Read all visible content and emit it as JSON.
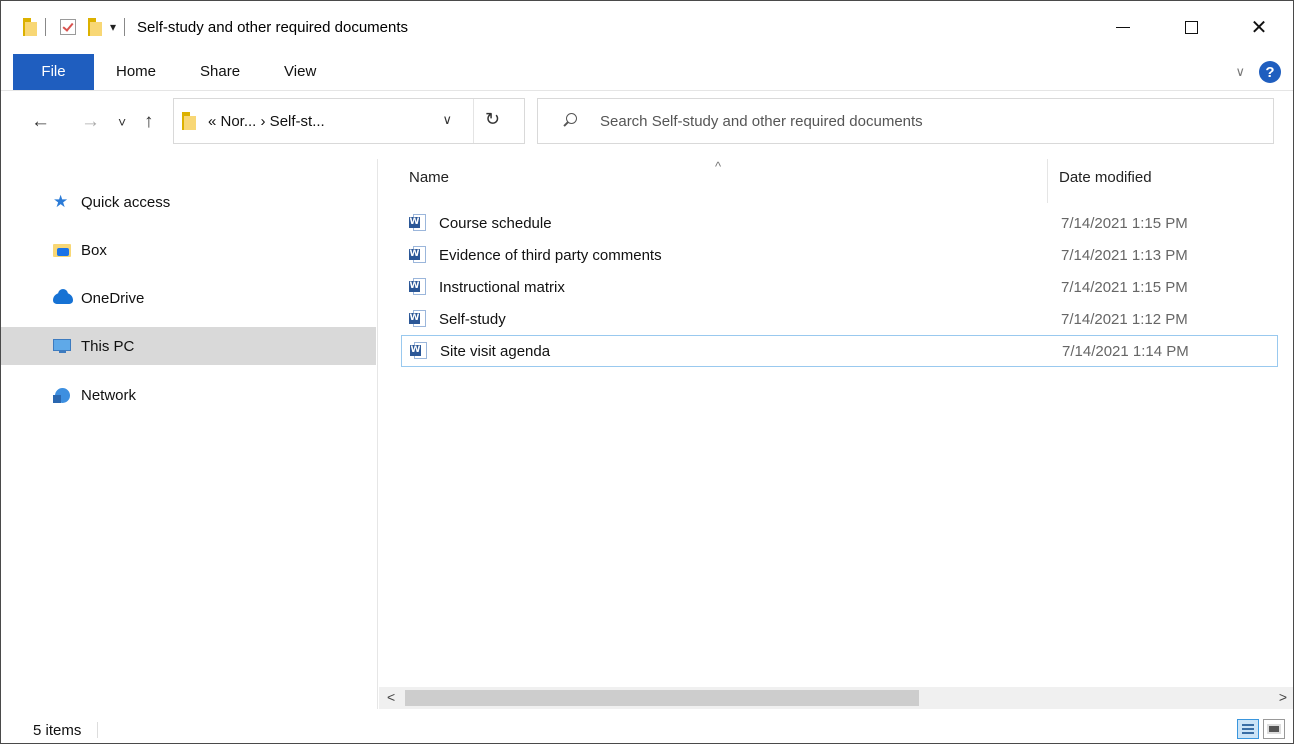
{
  "window": {
    "title": "Self-study and other required documents"
  },
  "ribbon": {
    "tabs": [
      "File",
      "Home",
      "Share",
      "View"
    ],
    "help_label": "?"
  },
  "nav": {
    "back": "←",
    "forward": "→",
    "recent": "˅",
    "up": "↑",
    "address": "«  Nor...  ›  Self-st...",
    "address_dropdown": "∨",
    "refresh": "↻",
    "search_placeholder": "Search Self-study and other required documents"
  },
  "sidebar": {
    "items": [
      {
        "label": "Quick access",
        "icon": "star-icon"
      },
      {
        "label": "Box",
        "icon": "box-icon"
      },
      {
        "label": "OneDrive",
        "icon": "onedrive-icon"
      },
      {
        "label": "This PC",
        "icon": "computer-icon",
        "selected": true
      },
      {
        "label": "Network",
        "icon": "network-icon"
      }
    ]
  },
  "file_list": {
    "columns": {
      "name": "Name",
      "date": "Date modified"
    },
    "sort_indicator": "^",
    "rows": [
      {
        "name": "Course schedule",
        "date": "7/14/2021 1:15 PM"
      },
      {
        "name": "Evidence of third party comments",
        "date": "7/14/2021 1:13 PM"
      },
      {
        "name": "Instructional matrix",
        "date": "7/14/2021 1:15 PM"
      },
      {
        "name": "Self-study",
        "date": "7/14/2021 1:12 PM"
      },
      {
        "name": "Site visit agenda",
        "date": "7/14/2021 1:14 PM",
        "focused": true
      }
    ]
  },
  "scrollbar": {
    "left": "<",
    "right": ">"
  },
  "status": {
    "count": "5 items"
  },
  "colors": {
    "accent": "#1f5ebf",
    "selected_bg": "#d9d9d9",
    "focus_border": "#99c9ef"
  }
}
